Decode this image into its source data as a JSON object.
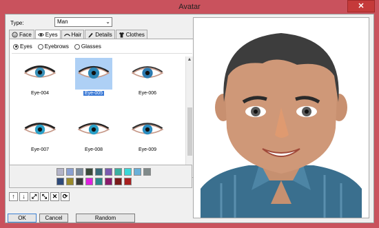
{
  "window": {
    "title": "Avatar",
    "close_label": "✕"
  },
  "type": {
    "label": "Type:",
    "value": "Man"
  },
  "tabs": [
    {
      "label": "Face",
      "icon": "smiley-icon"
    },
    {
      "label": "Eyes",
      "icon": "eye-icon"
    },
    {
      "label": "Hair",
      "icon": "eyebrow-icon"
    },
    {
      "label": "Details",
      "icon": "pencil-icon"
    },
    {
      "label": "Clothes",
      "icon": "shirt-icon"
    }
  ],
  "radios": [
    {
      "label": "Eyes",
      "checked": true
    },
    {
      "label": "Eyebrows",
      "checked": false
    },
    {
      "label": "Glasses",
      "checked": false
    }
  ],
  "items": [
    {
      "label": "Eye-004",
      "selected": false
    },
    {
      "label": "Eye-005",
      "selected": true
    },
    {
      "label": "Eye-006",
      "selected": false
    },
    {
      "label": "Eye-007",
      "selected": false
    },
    {
      "label": "Eye-008",
      "selected": false
    },
    {
      "label": "Eye-009",
      "selected": false
    }
  ],
  "palette": [
    "#b4b4c8",
    "#8aa0d2",
    "#7b8c9e",
    "#3a4a3a",
    "#3a6a78",
    "#7a5ab0",
    "#3ab0a0",
    "#3ad8d8",
    "#6ab0d8",
    "#808a8a",
    "#2e4a7a",
    "#9a8a2a",
    "#3a3a3a",
    "#e020e0",
    "#2a8a8a",
    "#8a1a6a",
    "#7a1a1a",
    "#a82020"
  ],
  "tools": [
    "↑",
    "↓",
    "⤢",
    "⤡",
    "✕",
    "⟳"
  ],
  "buttons": {
    "ok": "OK",
    "cancel": "Cancel",
    "random": "Random"
  },
  "colors": {
    "accent": "#3a79d6",
    "frame": "#c9525d"
  }
}
